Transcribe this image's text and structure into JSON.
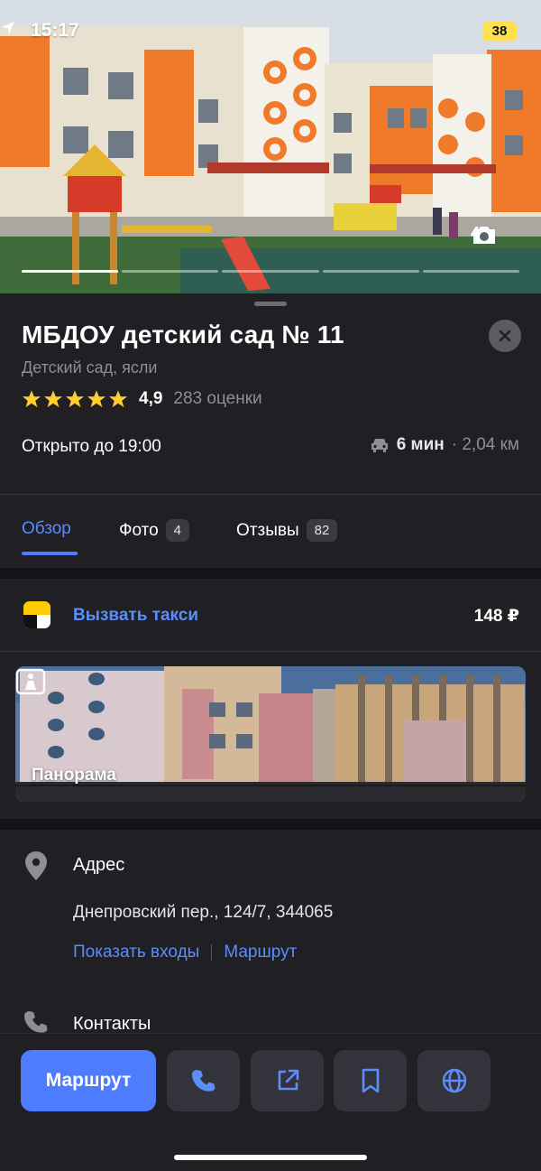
{
  "status_bar": {
    "time": "15:17",
    "battery": "38"
  },
  "hero": {
    "photo_count": "4",
    "photo_progress": {
      "total": 5,
      "current": 1
    }
  },
  "place": {
    "title": "МБДОУ детский сад № 11",
    "category": "Детский сад, ясли",
    "rating": "4,9",
    "rating_count": "283 оценки",
    "hours": "Открыто до 19:00",
    "drive_time": "6 мин",
    "distance": "· 2,04 км"
  },
  "tabs": [
    {
      "label": "Обзор"
    },
    {
      "label": "Фото",
      "badge": "4"
    },
    {
      "label": "Отзывы",
      "badge": "82"
    }
  ],
  "taxi": {
    "label": "Вызвать такси",
    "price": "148 ₽"
  },
  "panorama": {
    "label": "Панорама"
  },
  "address": {
    "title": "Адрес",
    "text": "Днепровский пер., 124/7, 344065",
    "show_entrances": "Показать входы",
    "route": "Маршрут"
  },
  "contacts": {
    "title": "Контакты"
  },
  "actions": {
    "route_label": "Маршрут"
  },
  "colors": {
    "accent": "#4d7cfe",
    "link": "#5d8dfb",
    "star": "#ffcc33",
    "battery": "#ffe14d"
  }
}
